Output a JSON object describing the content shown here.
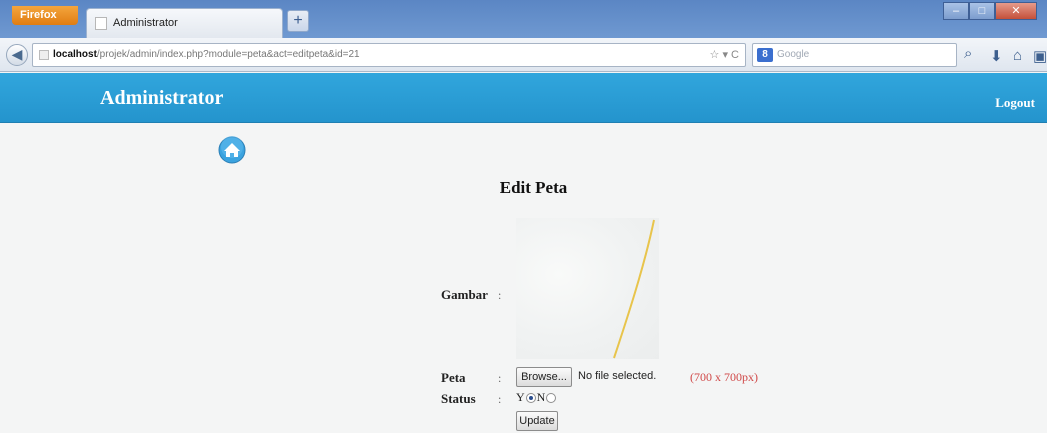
{
  "browser": {
    "menu_button": "Firefox",
    "tab_title": "Administrator",
    "url_host": "localhost",
    "url_path": "/projek/admin/index.php?module=peta&act=editpeta&id=21",
    "search_engine_badge": "8",
    "search_placeholder": "Google"
  },
  "header": {
    "brand": "Administrator",
    "logout_label": "Logout",
    "background_color": "#2a9cd5"
  },
  "form": {
    "title": "Edit Peta",
    "gambar_label": "Gambar",
    "peta_label": "Peta",
    "browse_label": "Browse...",
    "file_status": "No file selected.",
    "size_hint": "(700 x 700px)",
    "status_label": "Status",
    "status_options": [
      "Y",
      "N"
    ],
    "status_selected": "Y",
    "update_label": "Update"
  },
  "icons": {
    "home": "home-icon",
    "back": "back-arrow-icon",
    "search": "magnifier-icon"
  }
}
